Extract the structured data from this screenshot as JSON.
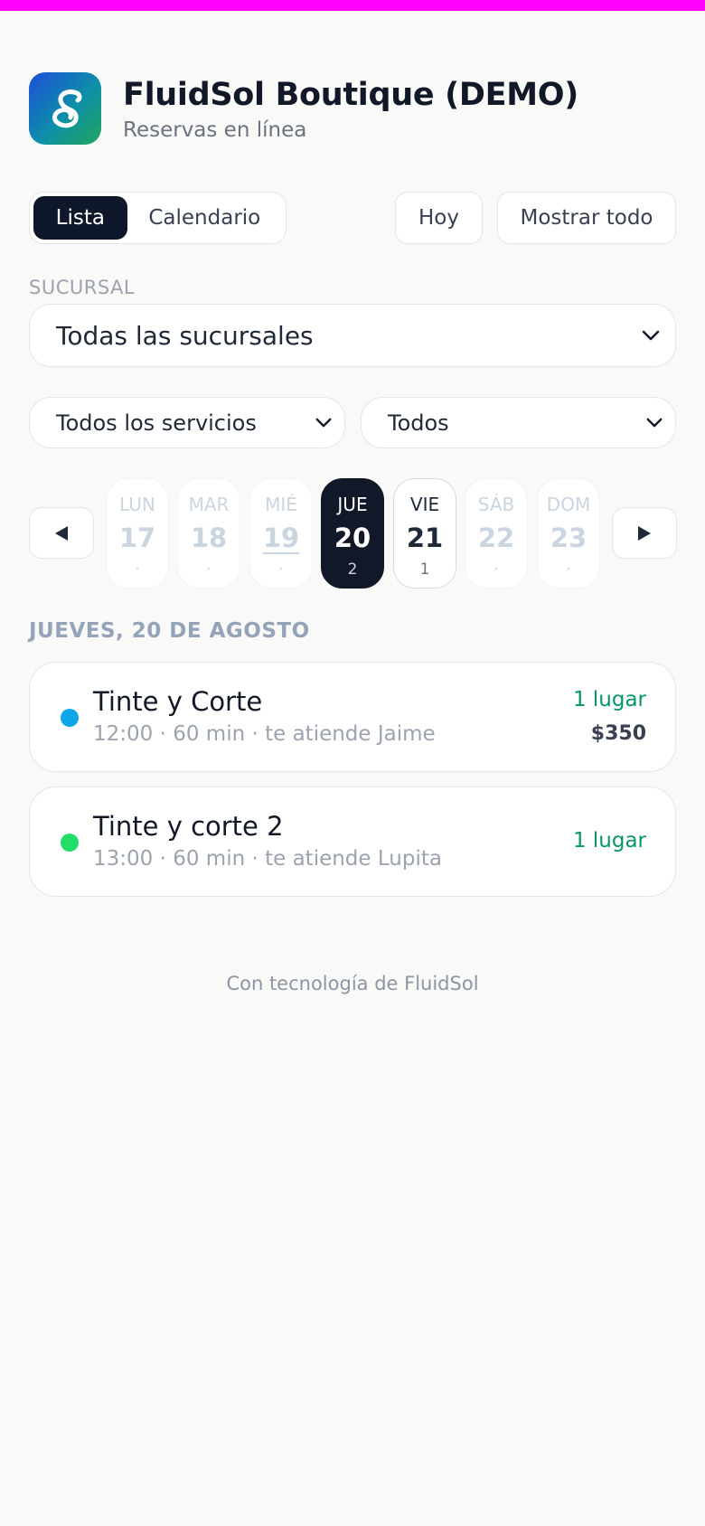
{
  "app": {
    "title": "FluidSol Boutique (DEMO)",
    "subtitle": "Reservas en línea",
    "logo_icon": "infinity-loop-icon"
  },
  "view_toggle": {
    "options": [
      "Lista",
      "Calendario"
    ],
    "selected": "Lista"
  },
  "actions": {
    "today": "Hoy",
    "show_all": "Mostrar todo"
  },
  "filters": {
    "branch_label": "SUCURSAL",
    "branch_value": "Todas las sucursales",
    "service_value": "Todos los servicios",
    "staff_value": "Todos"
  },
  "week": {
    "days": [
      {
        "name": "LUN",
        "num": "17",
        "count": "·"
      },
      {
        "name": "MAR",
        "num": "18",
        "count": "·"
      },
      {
        "name": "MIÉ",
        "num": "19",
        "count": "·"
      },
      {
        "name": "JUE",
        "num": "20",
        "count": "2"
      },
      {
        "name": "VIE",
        "num": "21",
        "count": "1"
      },
      {
        "name": "SÁB",
        "num": "22",
        "count": "·"
      },
      {
        "name": "DOM",
        "num": "23",
        "count": "·"
      }
    ],
    "selected_index": 3
  },
  "date_heading": "JUEVES, 20 DE AGOSTO",
  "slots": [
    {
      "service": "Tinte y Corte",
      "meta": "12:00 · 60 min · te atiende Jaime",
      "spots": "1 lugar",
      "price": "$350",
      "color": "#0ea5e9"
    },
    {
      "service": "Tinte y corte 2",
      "meta": "13:00 · 60 min · te atiende Lupita",
      "spots": "1 lugar",
      "color": "#22dd6a"
    }
  ],
  "footer": "Con tecnología de FluidSol",
  "colors": {
    "accent_dark": "#111827",
    "available": "#059669",
    "topbar": "#ff00ff"
  }
}
